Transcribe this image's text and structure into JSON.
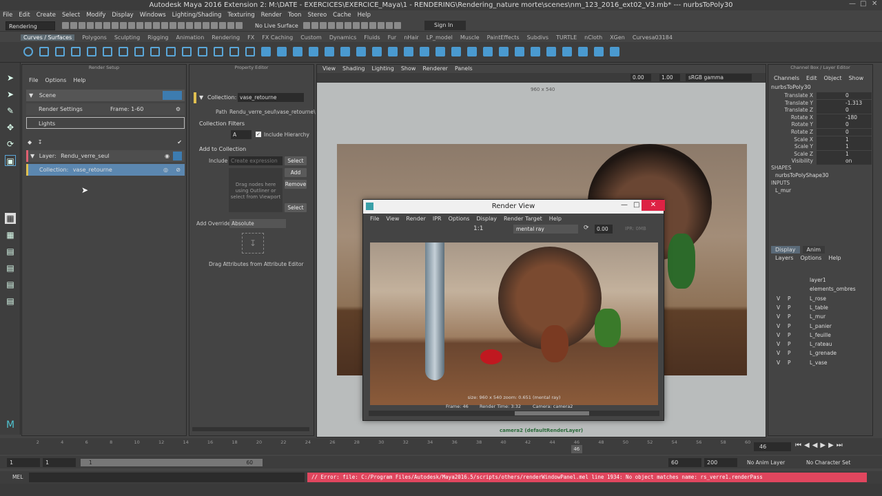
{
  "window": {
    "title": "Autodesk Maya 2016 Extension 2: M:\\DATE - EXERCICES\\EXERCICE_Maya\\1 - RENDERING\\Rendering_nature morte\\scenes\\nm_123_2016_ext02_V3.mb*   ---   nurbsToPoly30"
  },
  "menubar": [
    "File",
    "Edit",
    "Create",
    "Select",
    "Modify",
    "Display",
    "Windows",
    "Lighting/Shading",
    "Texturing",
    "Render",
    "Toon",
    "Stereo",
    "Cache",
    "Help"
  ],
  "statusline": {
    "mode": "Rendering",
    "live_surface": "No Live Surface",
    "signin": "Sign In"
  },
  "shelf_tabs": [
    "Curves / Surfaces",
    "Polygons",
    "Sculpting",
    "Rigging",
    "Animation",
    "Rendering",
    "FX",
    "FX Caching",
    "Custom",
    "Dynamics",
    "Fluids",
    "Fur",
    "nHair",
    "LP_model",
    "Muscle",
    "PaintEffects",
    "Subdivs",
    "TURTLE",
    "nCloth",
    "XGen",
    "Curvesa03184"
  ],
  "render_setup": {
    "title": "Render Setup",
    "menu": [
      "File",
      "Options",
      "Help"
    ],
    "scene_label": "Scene",
    "render_settings": "Render Settings",
    "frame": "Frame: 1-60",
    "lights": "Lights",
    "layer_label": "Layer:",
    "layer_name": "Rendu_verre_seul",
    "collection_label": "Collection:",
    "collection_name": "vase_retourne"
  },
  "property_editor": {
    "title": "Property Editor",
    "collection_label": "Collection:",
    "collection_value": "vase_retourne",
    "path_label": "Path",
    "path_value": "Rendu_verre_seul\\vase_retourne\\",
    "filters_title": "Collection Filters",
    "filter_value": "A",
    "include_hierarchy": "Include Hierarchy",
    "add_title": "Add to Collection",
    "include_label": "Include",
    "include_placeholder": "Create expression",
    "select_btn": "Select",
    "add_btn": "Add",
    "remove_btn": "Remove",
    "select_btn2": "Select",
    "drag_text": "Drag nodes here using Outliner or select from Viewport",
    "override_label": "Add Override",
    "override_value": "Absolute",
    "drag_attr_text": "Drag Attributes from Attribute Editor"
  },
  "viewport": {
    "menu": [
      "View",
      "Shading",
      "Lighting",
      "Show",
      "Renderer",
      "Panels"
    ],
    "exposure": "0.00",
    "gamma": "1.00",
    "colorspace": "sRGB gamma",
    "resolution": "960 x 540",
    "camera_label": "camera2 (defaultRenderLayer)"
  },
  "render_view": {
    "title": "Render View",
    "menu": [
      "File",
      "View",
      "Render",
      "IPR",
      "Options",
      "Display",
      "Render Target",
      "Help"
    ],
    "ratio": "1:1",
    "renderer": "mental ray",
    "value": "0.00",
    "ipr": "IPR: 0MB",
    "size_info": "size: 960 x 540  zoom: 0.651        (mental ray)",
    "frame_info": "Frame: 46",
    "render_time": "Render Time:  3:32",
    "camera_info": "Camera: camera2"
  },
  "channel_box": {
    "title": "Channel Box / Layer Editor",
    "menu": [
      "Channels",
      "Edit",
      "Object",
      "Show"
    ],
    "object": "nurbsToPoly30",
    "attributes": [
      {
        "name": "Translate X",
        "value": "0"
      },
      {
        "name": "Translate Y",
        "value": "-1.313"
      },
      {
        "name": "Translate Z",
        "value": "0"
      },
      {
        "name": "Rotate X",
        "value": "-180"
      },
      {
        "name": "Rotate Y",
        "value": "0"
      },
      {
        "name": "Rotate Z",
        "value": "0"
      },
      {
        "name": "Scale X",
        "value": "1"
      },
      {
        "name": "Scale Y",
        "value": "1"
      },
      {
        "name": "Scale Z",
        "value": "1"
      },
      {
        "name": "Visibility",
        "value": "on"
      }
    ],
    "shapes_label": "SHAPES",
    "shape_name": "nurbsToPolyShape30",
    "inputs_label": "INPUTS",
    "input_name": "L_mur",
    "tabs": [
      "Display",
      "Anim"
    ],
    "layer_menu": [
      "Layers",
      "Options",
      "Help"
    ],
    "layers": [
      {
        "v": "",
        "p": "",
        "name": "layer1"
      },
      {
        "v": "",
        "p": "",
        "name": "elements_ombres"
      },
      {
        "v": "V",
        "p": "P",
        "name": "L_rose"
      },
      {
        "v": "V",
        "p": "P",
        "name": "L_table"
      },
      {
        "v": "V",
        "p": "P",
        "name": "L_mur"
      },
      {
        "v": "V",
        "p": "P",
        "name": "L_panier"
      },
      {
        "v": "V",
        "p": "P",
        "name": "L_feuille"
      },
      {
        "v": "V",
        "p": "P",
        "name": "L_rateau"
      },
      {
        "v": "V",
        "p": "P",
        "name": "L_grenade"
      },
      {
        "v": "V",
        "p": "P",
        "name": "L_vase"
      }
    ]
  },
  "timeline": {
    "ticks": [
      "2",
      "4",
      "6",
      "8",
      "10",
      "12",
      "14",
      "16",
      "18",
      "20",
      "22",
      "24",
      "26",
      "28",
      "30",
      "32",
      "34",
      "36",
      "38",
      "40",
      "42",
      "44",
      "46",
      "48",
      "50",
      "52",
      "54",
      "56",
      "58",
      "60"
    ],
    "current_frame": "46",
    "range_start": "1",
    "range_start2": "1",
    "slider_start": "1",
    "slider_end": "60",
    "end1": "60",
    "end2": "200",
    "anim_layer": "No Anim Layer",
    "char_set": "No Character Set"
  },
  "command": {
    "label": "MEL",
    "error": "// Error: file: C:/Program Files/Autodesk/Maya2016.5/scripts/others/renderWindowPanel.mel line 1934: No object matches name: rs_verre1.renderPass"
  }
}
